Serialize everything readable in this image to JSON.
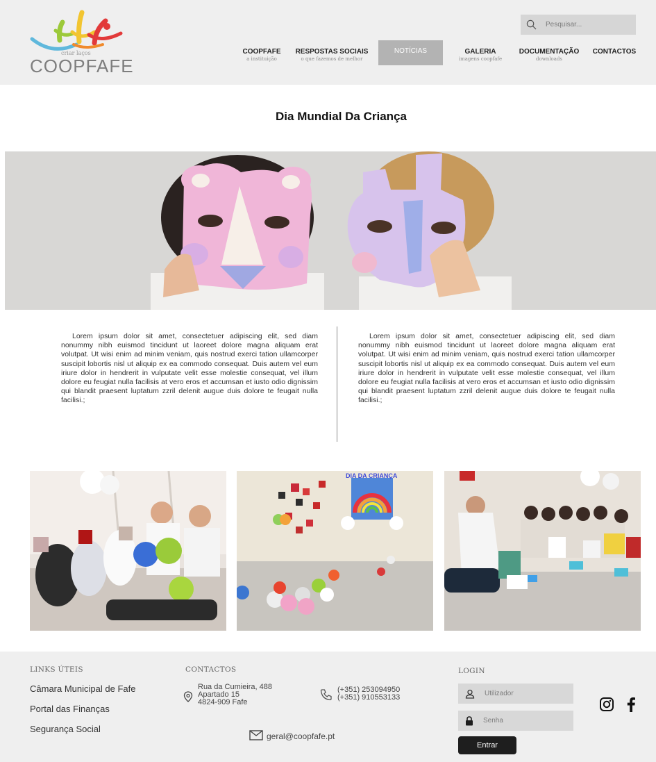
{
  "header": {
    "logo": {
      "tagline": "criar laços",
      "name": "COOPFAFE"
    },
    "search": {
      "placeholder": "Pesquisar..."
    },
    "nav": [
      {
        "label": "COOPFAFE",
        "sub": "a instituição"
      },
      {
        "label": "RESPOSTAS SOCIAIS",
        "sub": "o que fazemos de melhor"
      },
      {
        "label": "NOTÍCIAS",
        "sub": ""
      },
      {
        "label": "GALERIA",
        "sub": "imagens coopfafe"
      },
      {
        "label": "DOCUMENTAÇÃO",
        "sub": "downloads"
      },
      {
        "label": "CONTACTOS",
        "sub": ""
      }
    ],
    "active_nav": "NOTÍCIAS"
  },
  "article": {
    "title": "Dia Mundial Da Criança",
    "col_left": "Lorem ipsum dolor sit amet, consectetuer adipiscing elit, sed diam nonummy nibh euismod tincidunt ut laoreet dolore magna aliquam erat volutpat. Ut wisi enim ad minim veniam, quis nostrud exerci tation ullamcorper suscipit lobortis nisl ut aliquip ex ea commodo consequat. Duis autem vel eum iriure dolor in hendrerit in vulputate velit esse molestie consequat, vel illum dolore eu feugiat nulla facilisis at vero eros et accumsan et iusto odio dignissim qui blandit praesent luptatum zzril delenit augue duis dolore te feugait nulla facilisi.;",
    "col_right": "Lorem ipsum dolor sit amet, consectetuer adipiscing elit, sed diam nonummy nibh euismod tincidunt ut laoreet dolore magna aliquam erat volutpat. Ut wisi enim ad minim veniam, quis nostrud exerci tation ullamcorper suscipit lobortis nisl ut aliquip ex ea commodo consequat. Duis autem vel eum iriure dolor in hendrerit in vulputate velit esse molestie consequat, vel illum dolore eu feugiat nulla facilisis at vero eros et accumsan et iusto odio dignissim qui blandit praesent luptatum zzril delenit augue duis dolore te feugait nulla facilisi.;",
    "poster_text": "DIA DA CRIANÇA"
  },
  "footer": {
    "links_heading": "LINKS ÚTEIS",
    "links": [
      "Câmara Municipal de Fafe",
      "Portal das Finanças",
      "Segurança Social"
    ],
    "contacts_heading": "CONTACTOS",
    "address": [
      "Rua da Cumieira, 488",
      "Apartado 15",
      "4824-909 Fafe"
    ],
    "phones": [
      "(+351) 253094950",
      "(+351) 910553133"
    ],
    "email": "geral@coopfafe.pt",
    "login_heading": "LOGIN",
    "user_placeholder": "Utilizador",
    "password_placeholder": "Senha",
    "login_button": "Entrar",
    "social": [
      "instagram-icon",
      "facebook-icon"
    ]
  },
  "colors": {
    "header_bg": "#efefef",
    "nav_active_bg": "#b3b3b3",
    "footer_bg": "#efefef",
    "button_dark": "#1e1e1e",
    "logo_blue": "#5fb8dc",
    "logo_green": "#9cc93a",
    "logo_yellow": "#f2c531",
    "logo_red": "#e23a3a"
  }
}
